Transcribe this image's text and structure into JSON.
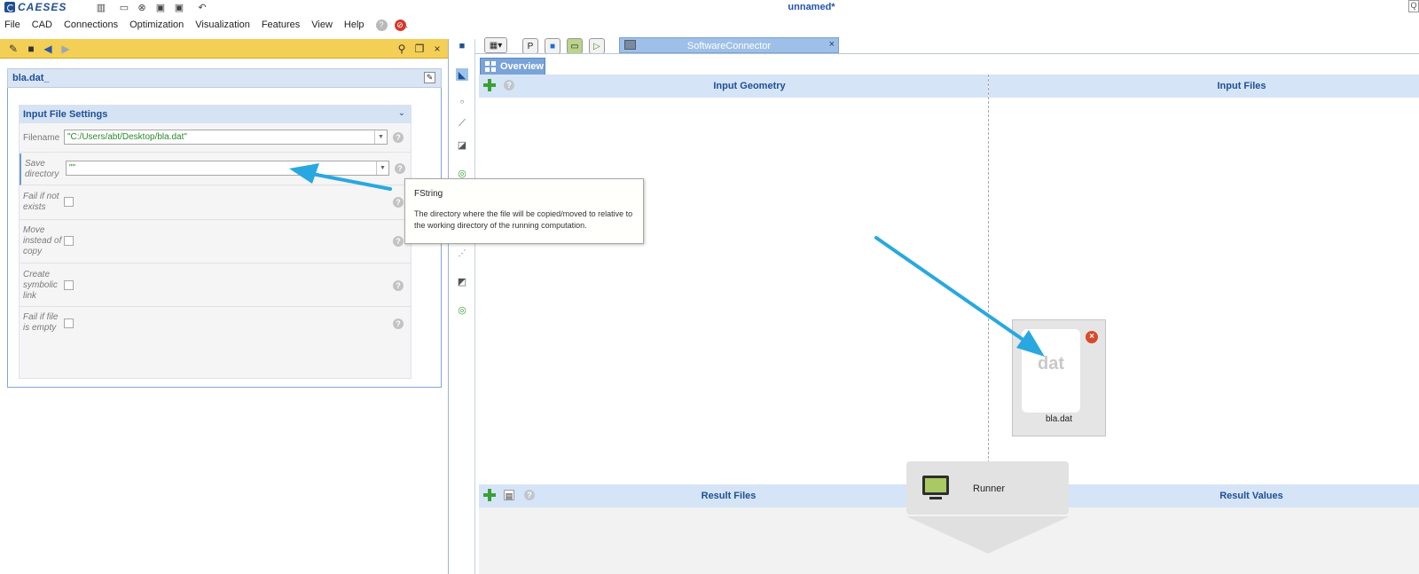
{
  "app": {
    "logo_text": "CAESES",
    "window_title": "unnamed*",
    "corner_text": "Q"
  },
  "quick_toolbar": [
    {
      "icon": "layout-icon",
      "glyph": "▥"
    },
    {
      "icon": "new-file-icon",
      "glyph": "▭"
    },
    {
      "icon": "close-circle-icon",
      "glyph": "⊗"
    },
    {
      "icon": "save-icon",
      "glyph": "▣"
    },
    {
      "icon": "save-as-icon",
      "glyph": "▣"
    },
    {
      "icon": "undo-icon",
      "glyph": "↶"
    }
  ],
  "menu": {
    "items": [
      "File",
      "CAD",
      "Connections",
      "Optimization",
      "Visualization",
      "Features",
      "View",
      "Help"
    ],
    "help_glyph": "?",
    "stop_glyph": "⊘",
    "trail": "."
  },
  "left_panel": {
    "object_name": "bla.dat_",
    "section_title": "Input File Settings",
    "rows": [
      {
        "label": "Filename",
        "value": "\"C:/Users/abt/Desktop/bla.dat\"",
        "type": "text"
      },
      {
        "label": "Save directory",
        "value": "\"\"",
        "type": "text"
      },
      {
        "label": "Fail if not exists",
        "type": "checkbox",
        "checked": false
      },
      {
        "label": "Move instead of copy",
        "type": "checkbox",
        "checked": false
      },
      {
        "label": "Create symbolic link",
        "type": "checkbox",
        "checked": false
      },
      {
        "label": "Fail if file is empty",
        "type": "checkbox",
        "checked": false
      }
    ],
    "help_glyph": "?"
  },
  "tooltip": {
    "title": "FString",
    "body": "The directory where the file will be copied/moved to relative to the working directory of the running computation."
  },
  "connector": {
    "tab_label": "SoftwareConnector",
    "tab_close": "×",
    "overview_label": "Overview",
    "input_geometry": "Input Geometry",
    "input_files": "Input Files",
    "result_files": "Result Files",
    "result_values": "Result Values",
    "runner_label": "Runner",
    "file": {
      "ext": "dat",
      "name": "bla.dat",
      "remove_glyph": "×"
    }
  },
  "colors": {
    "accent": "#1f4f95",
    "header_bg": "#d5e4f6",
    "yellow_toolbar": "#f3cf55",
    "arrow": "#29a8e0"
  }
}
